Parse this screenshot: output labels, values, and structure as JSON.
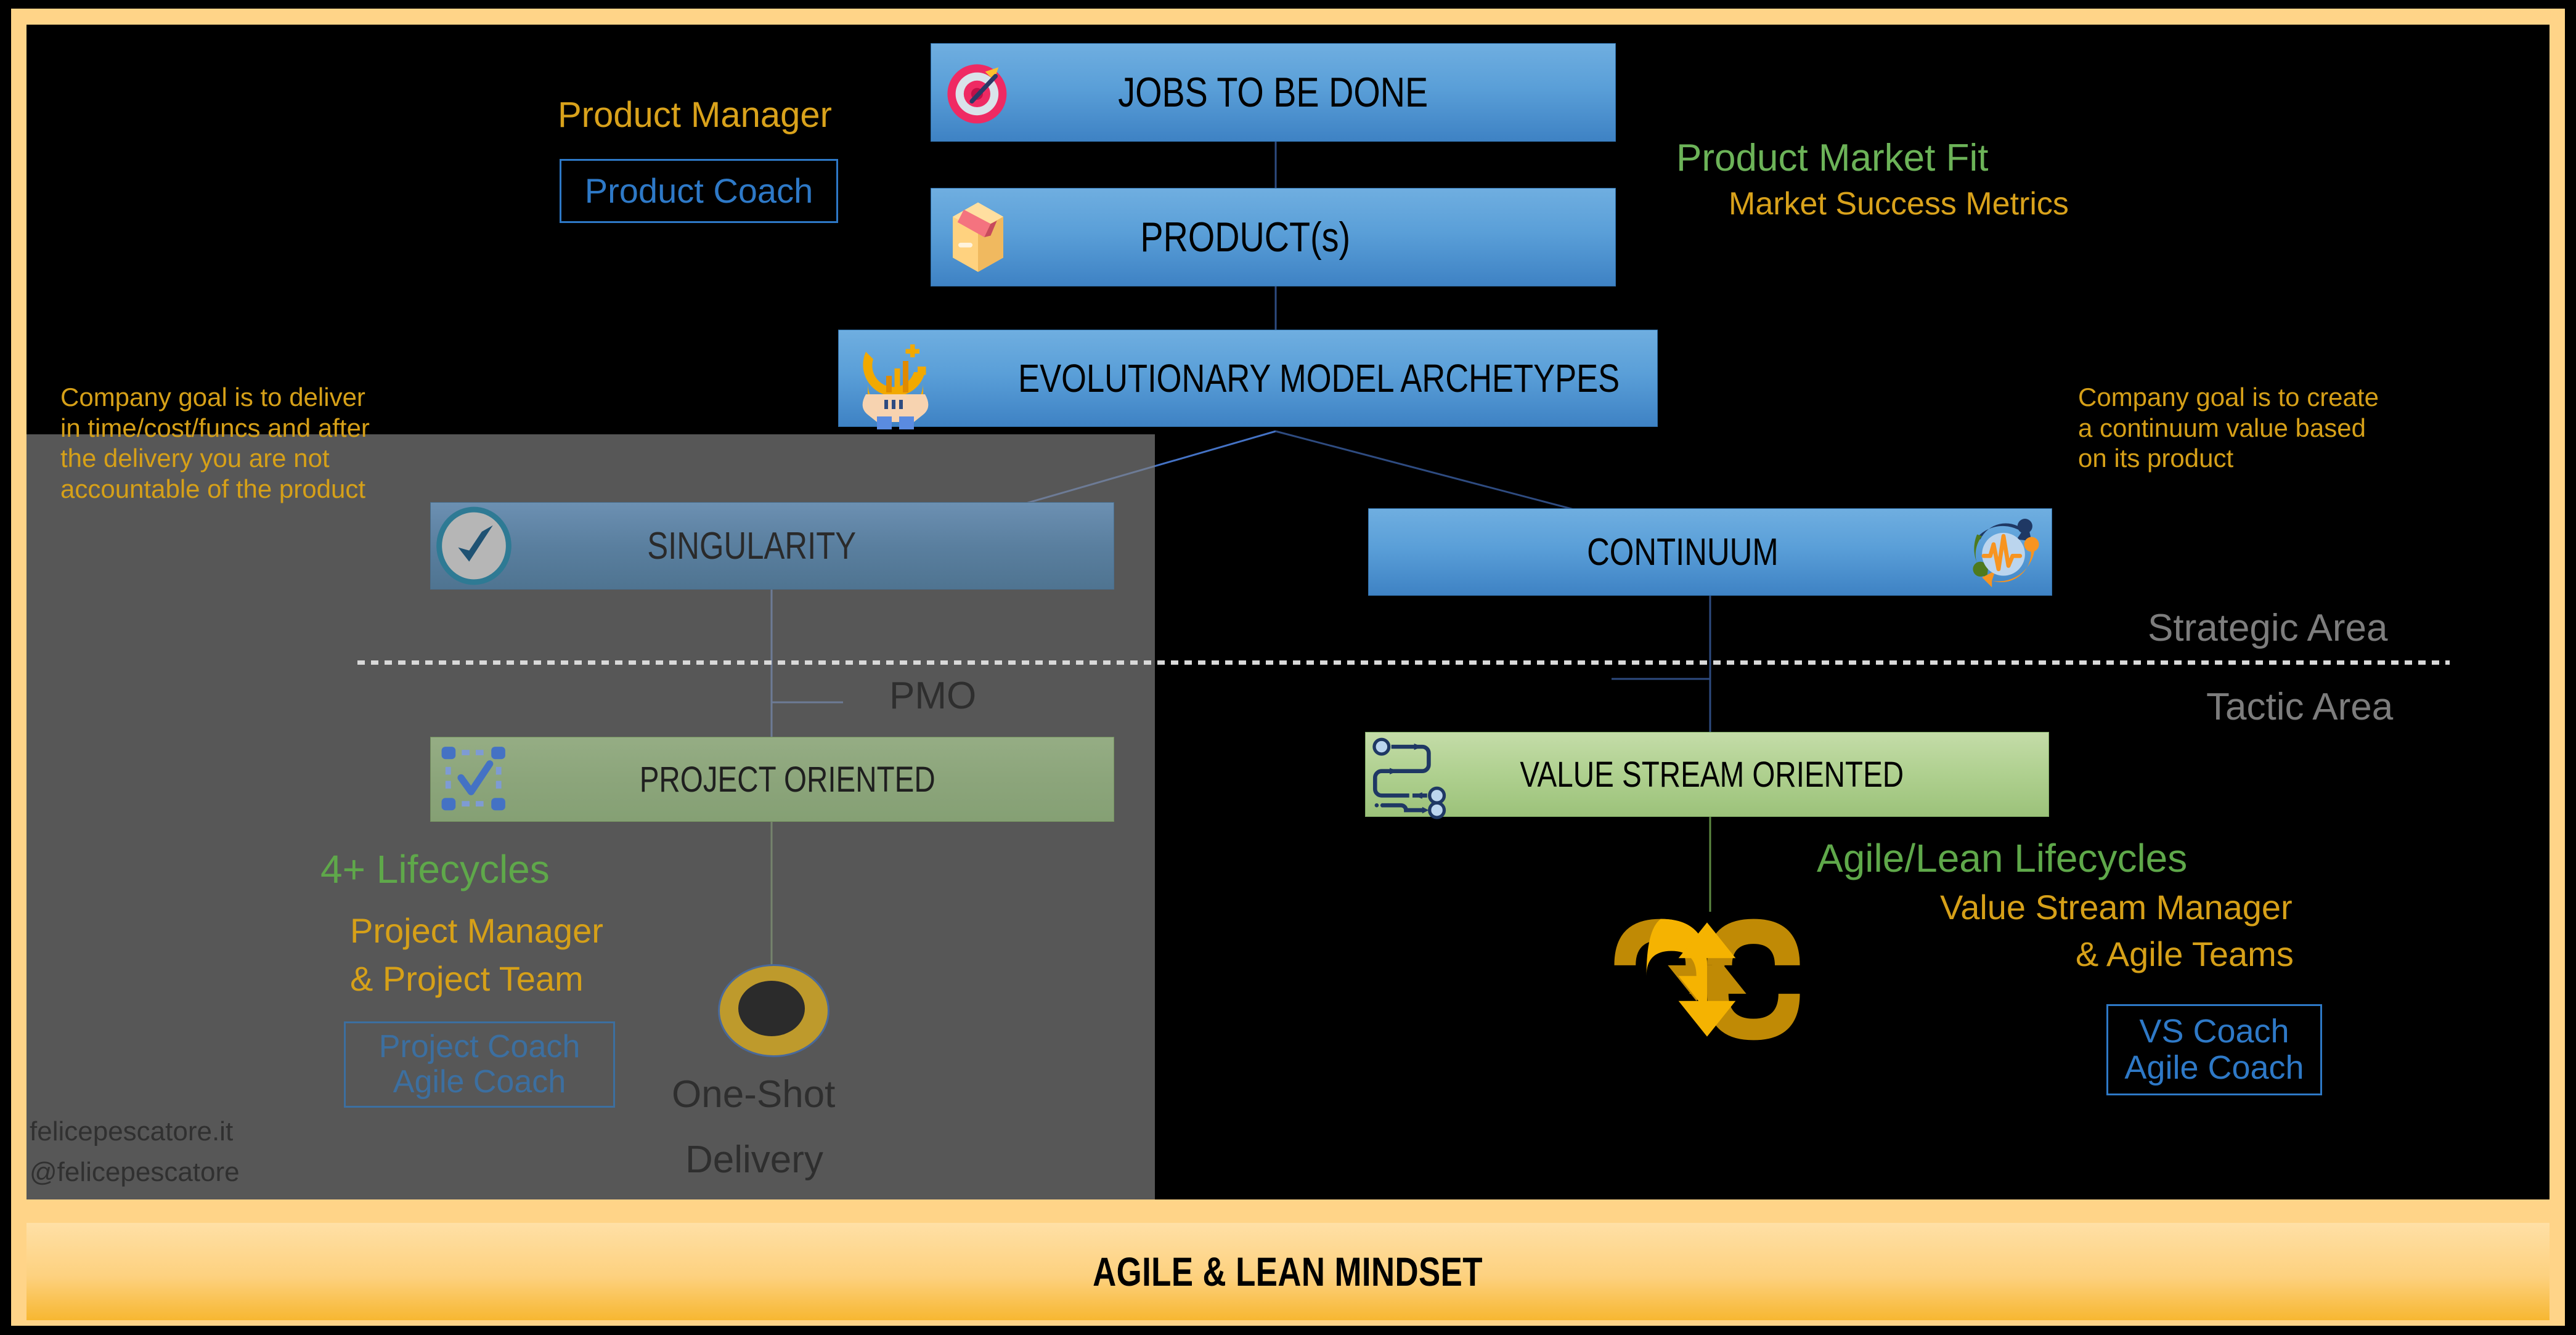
{
  "frame": {
    "accent_color": "#FFD488",
    "background_color": "#000000"
  },
  "banner": {
    "label": "AGILE & LEAN MINDSET"
  },
  "top_flow": {
    "jobs_to_be_done": {
      "label": "JOBS TO BE DONE",
      "icon": "target-dart-icon"
    },
    "products": {
      "label": "PRODUCT(s)",
      "icon": "package-box-icon"
    },
    "archetypes": {
      "label": "EVOLUTIONARY MODEL ARCHETYPES",
      "icon": "hand-holding-growth-icon"
    }
  },
  "left_roles": {
    "manager_label": "Product Manager",
    "coach_chip": {
      "line1": "Product Coach"
    }
  },
  "product_market_fit": {
    "title": "Product Market Fit",
    "subtitle": "Market Success Metrics",
    "title_color": "#6CB358",
    "subtitle_color": "#D9A21B"
  },
  "goals": {
    "left": "Company goal is to deliver\nin time/cost/funcs and after\nthe delivery you are not\naccountable of the product",
    "right": "Company goal is to create\na continuum value based\non its product"
  },
  "branches": {
    "singularity": {
      "label": "SINGULARITY",
      "icon": "check-circle-icon"
    },
    "continuum": {
      "label": "CONTINUUM",
      "icon": "cycle-pulse-network-icon"
    },
    "project_oriented": {
      "label": "PROJECT ORIENTED",
      "icon": "dashed-box-check-icon"
    },
    "value_stream_oriented": {
      "label": "VALUE STREAM ORIENTED",
      "icon": "value-stream-flow-icon"
    }
  },
  "areas": {
    "strategic": "Strategic Area",
    "tactic": "Tactic Area",
    "pmo": "PMO"
  },
  "left_details": {
    "lifecycles": "4+ Lifecycles",
    "role_line1": "Project Manager",
    "role_line2": "& Project Team",
    "coach_chip": {
      "line1": "Project Coach",
      "line2": "Agile Coach"
    },
    "outcome_line1": "One-Shot",
    "outcome_line2": "Delivery",
    "outcome_icon": "one-shot-dot-icon"
  },
  "right_details": {
    "lifecycles": "Agile/Lean Lifecycles",
    "role_line1": "Value Stream Manager",
    "role_line2": "& Agile Teams",
    "coach_chip": {
      "line1": "VS Coach",
      "line2": "Agile Coach"
    },
    "outcome_icon": "continuous-cycle-arrows-icon"
  },
  "credits": {
    "site": "felicepescatore.it",
    "handle": "@felicepescatore"
  }
}
